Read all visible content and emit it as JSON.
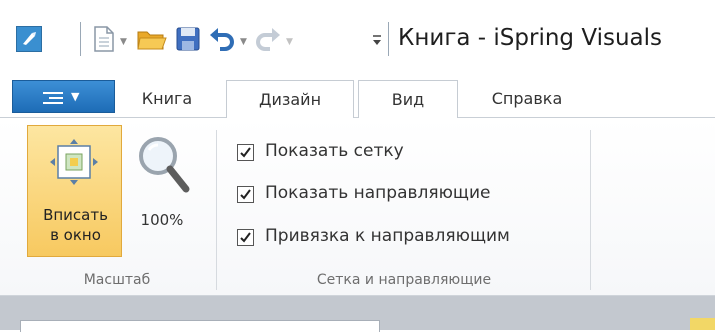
{
  "window": {
    "title": "Книга - iSpring Visuals"
  },
  "quick_access": {
    "icons": [
      "new-document-icon",
      "open-folder-icon",
      "save-icon",
      "undo-icon",
      "redo-icon",
      "customize-icon"
    ]
  },
  "tabs": {
    "file_icon": "menu-icon",
    "items": [
      {
        "label": "Книга"
      },
      {
        "label": "Дизайн"
      },
      {
        "label": "Вид",
        "active": true
      },
      {
        "label": "Справка"
      }
    ]
  },
  "ribbon": {
    "scale_group": {
      "label": "Масштаб",
      "fit_button": {
        "line1": "Вписать",
        "line2": "в окно"
      },
      "zoom_button": {
        "label": "100%"
      }
    },
    "grid_group": {
      "label": "Сетка и направляющие",
      "checkboxes": [
        {
          "label": "Показать сетку",
          "checked": true
        },
        {
          "label": "Показать направляющие",
          "checked": true
        },
        {
          "label": "Привязка к направляющим",
          "checked": true
        }
      ]
    }
  },
  "colors": {
    "accent_blue": "#1e6cb6",
    "highlight_orange": "#f7c960"
  }
}
